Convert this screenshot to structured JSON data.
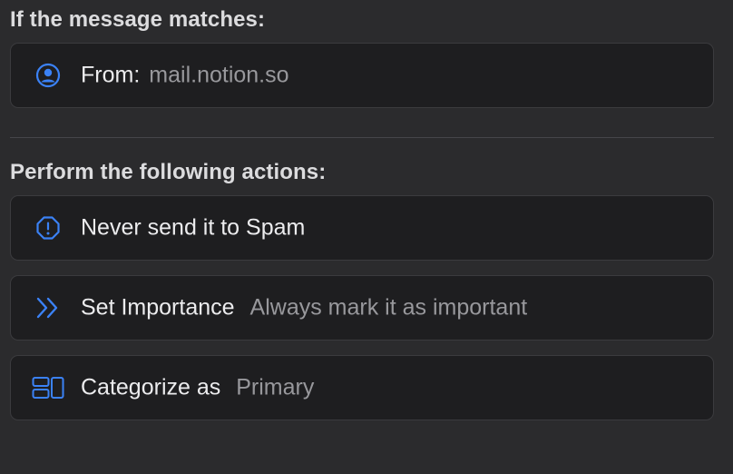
{
  "accent_color": "#3b82f6",
  "match_section": {
    "title": "If the message matches:",
    "condition": {
      "icon": "person-circle-icon",
      "label": "From:",
      "value": "mail.notion.so"
    }
  },
  "actions_section": {
    "title": "Perform the following actions:",
    "actions": [
      {
        "icon": "exclamation-octagon-icon",
        "label": "Never send it to Spam",
        "value": ""
      },
      {
        "icon": "double-chevron-right-icon",
        "label": "Set Importance",
        "value": "Always mark it as important"
      },
      {
        "icon": "category-layout-icon",
        "label": "Categorize as",
        "value": "Primary"
      }
    ]
  }
}
